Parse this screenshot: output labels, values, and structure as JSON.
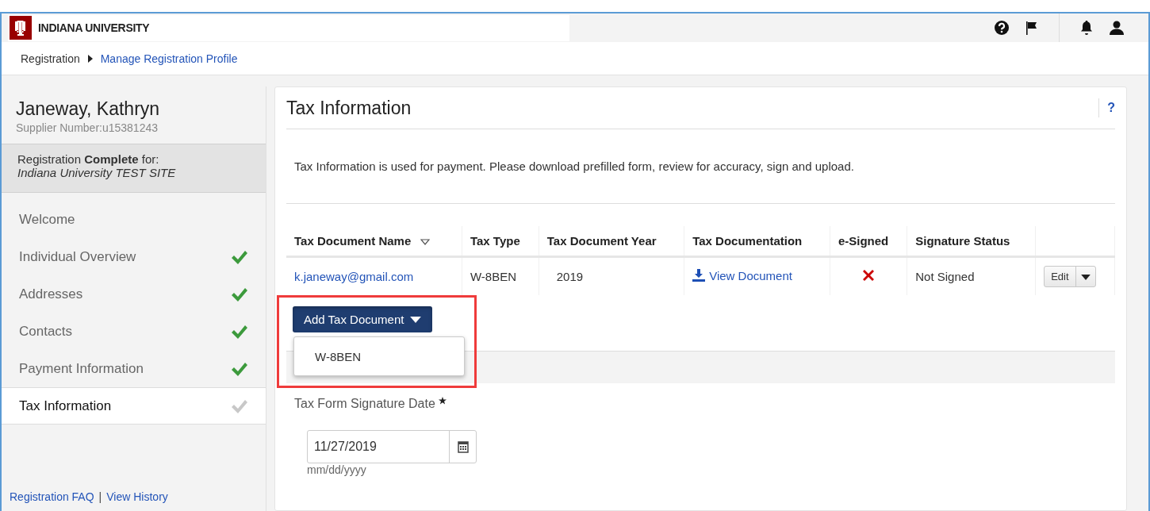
{
  "header": {
    "logo_text": "INDIANA UNIVERSITY"
  },
  "breadcrumb": [
    {
      "label": "Registration",
      "link": false
    },
    {
      "label": "Manage Registration Profile",
      "link": true
    }
  ],
  "profile": {
    "name": "Janeway, Kathryn",
    "supplier_number": "Supplier Number:u15381243",
    "status_text": "Registration **Complete** for:",
    "site": "Indiana University TEST SITE"
  },
  "nav": [
    {
      "label": "Welcome",
      "selected": false,
      "kind": "plain"
    },
    {
      "label": "Individual Overview",
      "selected": false,
      "kind": "complete"
    },
    {
      "label": "Addresses",
      "selected": false,
      "kind": "complete"
    },
    {
      "label": "Contacts",
      "selected": false,
      "kind": "complete"
    },
    {
      "label": "Payment Information",
      "selected": false,
      "kind": "complete"
    },
    {
      "label": "Tax Information",
      "selected": true,
      "kind": "incomplete"
    }
  ],
  "footer_links": [
    "Registration FAQ",
    "View History"
  ],
  "footer_separator": "|",
  "panel": {
    "title": "Tax Information",
    "help": "?",
    "intro": "Tax Information is used for payment. Please download prefilled form, review for accuracy, sign and upload."
  },
  "table": {
    "columns": [
      "Tax Document Name",
      "Tax Type",
      "Tax Document Year",
      "Tax Documentation",
      "e-Signed",
      "Signature Status"
    ],
    "rows": [
      {
        "name": "k.janeway@gmail.com",
        "type": "W-8BEN",
        "year": "2019",
        "documentation": "View Document",
        "e_signed": false,
        "status": "Not Signed",
        "action": "Edit"
      }
    ]
  },
  "add_button": {
    "label": "Add Tax Document",
    "expanded": true,
    "options": [
      "W-8BEN"
    ]
  },
  "signature_date": {
    "label": "Tax Form Signature Date",
    "value": "11/27/2019",
    "hint": "mm/dd/yyyy"
  }
}
